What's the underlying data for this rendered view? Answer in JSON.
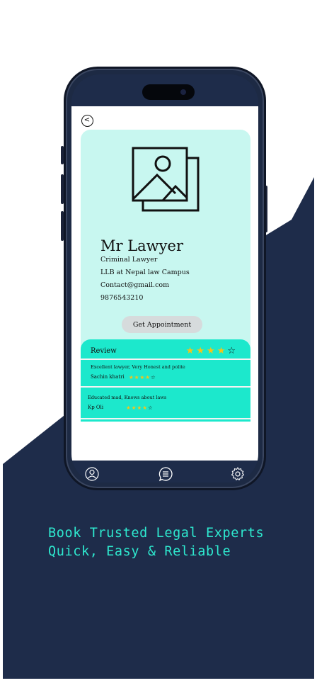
{
  "colors": {
    "navy": "#1e2c4a",
    "card_mint": "#c8f7f0",
    "review_teal": "#1ce8cc",
    "tagline_teal": "#2ee9cf",
    "star_gold": "#f5c518"
  },
  "profile": {
    "image_icon": "image-placeholder-icon",
    "name": "Mr Lawyer",
    "title": "Criminal Lawyer",
    "education": "LLB at Nepal law Campus",
    "email": "Contact@gmail.com",
    "phone": "9876543210",
    "appointment_label": "Get Appointment"
  },
  "review": {
    "title": "Review",
    "rating": 4,
    "max_rating": 5,
    "star_filled": "★",
    "star_empty": "☆",
    "items": [
      {
        "text": "Excellent lawyer, Very Honest and polite",
        "author": "Sachin khatri",
        "rating": 4
      },
      {
        "text": "Educated mad, Knows about laws",
        "author": "Kp Oli",
        "rating": 4
      }
    ]
  },
  "nav": {
    "items": [
      "profile-icon",
      "chat-icon",
      "settings-icon"
    ]
  },
  "back_icon": "chevron-left-icon",
  "back_glyph": "<",
  "tagline": {
    "line1": "Book Trusted Legal Experts",
    "line2": "Quick, Easy & Reliable"
  }
}
